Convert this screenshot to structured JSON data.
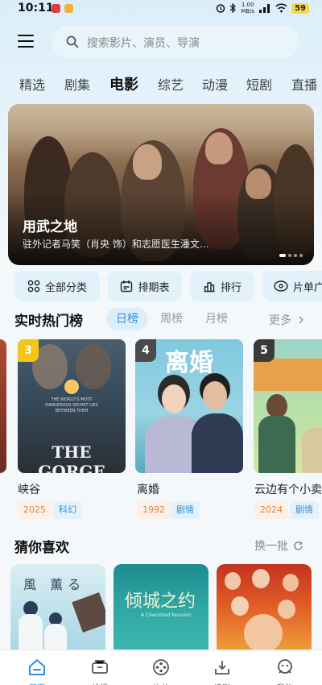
{
  "status_bar": {
    "time": "10:11",
    "net_speed_value": "1.00",
    "net_speed_unit": "MB/s",
    "battery": "59"
  },
  "header": {
    "search_placeholder": "搜索影片、演员、导演"
  },
  "category_tabs": [
    "精选",
    "剧集",
    "电影",
    "综艺",
    "动漫",
    "短剧",
    "直播"
  ],
  "active_category": "电影",
  "banner": {
    "title": "用武之地",
    "description": "驻外记者马笑（肖央 饰）和志愿医生潘文…",
    "slide_count": 4,
    "active_slide": 1
  },
  "quick_actions": [
    {
      "label": "全部分类",
      "icon": "grid-icon"
    },
    {
      "label": "排期表",
      "icon": "calendar-icon"
    },
    {
      "label": "排行",
      "icon": "ranking-icon"
    },
    {
      "label": "片单广",
      "icon": "film-list-icon"
    }
  ],
  "hot_ranking": {
    "title": "实时热门榜",
    "tabs": [
      "日榜",
      "周榜",
      "月榜"
    ],
    "active_tab": "日榜",
    "more_label": "更多",
    "items": [
      {
        "rank": "3",
        "name": "峡谷",
        "year": "2025",
        "genre": "科幻",
        "poster_title": "THE GORGE",
        "poster_tagline": "THE WORLD'S MOST DANGEROUS SECRET LIES BETWEEN THEM"
      },
      {
        "rank": "4",
        "name": "离婚",
        "year": "1992",
        "genre": "剧情",
        "poster_title": "离婚"
      },
      {
        "rank": "5",
        "name": "云边有个小卖",
        "year": "2024",
        "genre": "剧情"
      }
    ]
  },
  "guess_you_like": {
    "title": "猜你喜欢",
    "refresh_label": "换一批",
    "items": [
      {
        "poster_title": "風 薫る"
      },
      {
        "poster_title": "倾城之约",
        "poster_subtitle": "A Cherished Reunion"
      },
      {
        "poster_title": ""
      }
    ]
  },
  "bottom_nav": [
    {
      "label": "首页",
      "icon": "home-icon",
      "active": true
    },
    {
      "label": "排行",
      "icon": "ticket-icon",
      "active": false
    },
    {
      "label": "片单",
      "icon": "film-reel-icon",
      "active": false
    },
    {
      "label": "追剧",
      "icon": "tv-stack-icon",
      "active": false
    },
    {
      "label": "我的",
      "icon": "profile-icon",
      "active": false
    }
  ]
}
